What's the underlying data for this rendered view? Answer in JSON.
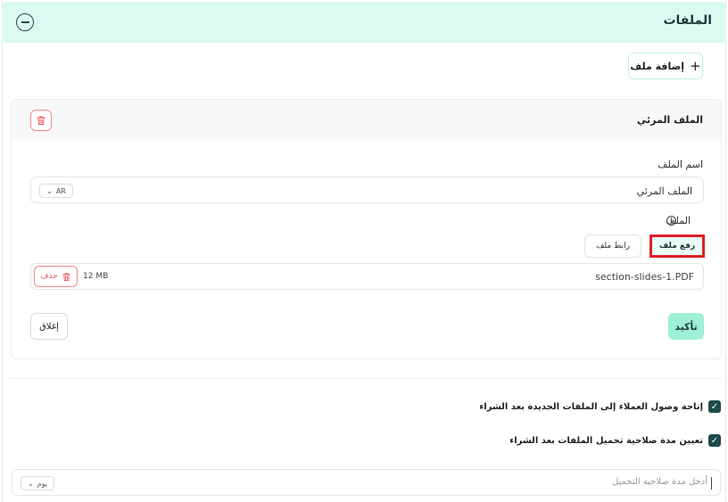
{
  "section": {
    "title": "الملفات"
  },
  "toolbar": {
    "add_file_label": "إضافة ملف"
  },
  "file_card": {
    "title": "الملف المرئي",
    "name_label": "اسم الملف",
    "name_value": "الملف المرئي",
    "lang": "AR",
    "file_label": "الملف",
    "tabs": {
      "upload": "رفع ملف",
      "link": "رابط ملف"
    },
    "file": {
      "name": "section-slides-1.PDF",
      "size": "12 MB",
      "delete_label": "حذف"
    },
    "confirm_label": "تأكيد",
    "close_label": "إغلاق"
  },
  "options": {
    "access_new_files": "إتاحة وصول العملاء إلى الملفات الجديدة بعد الشراء",
    "set_download_duration": "تعيين مدة صلاحية تحميل الملفات بعد الشراء",
    "duration_placeholder": "أدخل مدة صلاحية التحميل",
    "duration_unit": "يوم"
  },
  "colors": {
    "header_bg": "#dcfaf2",
    "accent": "#9ff0d6",
    "danger": "#f08a8a",
    "checkbox": "#1d4b4b"
  },
  "icons": {
    "collapse": "minus-circle-icon",
    "add": "plus-icon",
    "trash": "trash-icon",
    "info": "info-icon",
    "chevron": "chevron-down-icon",
    "check": "check-icon"
  }
}
